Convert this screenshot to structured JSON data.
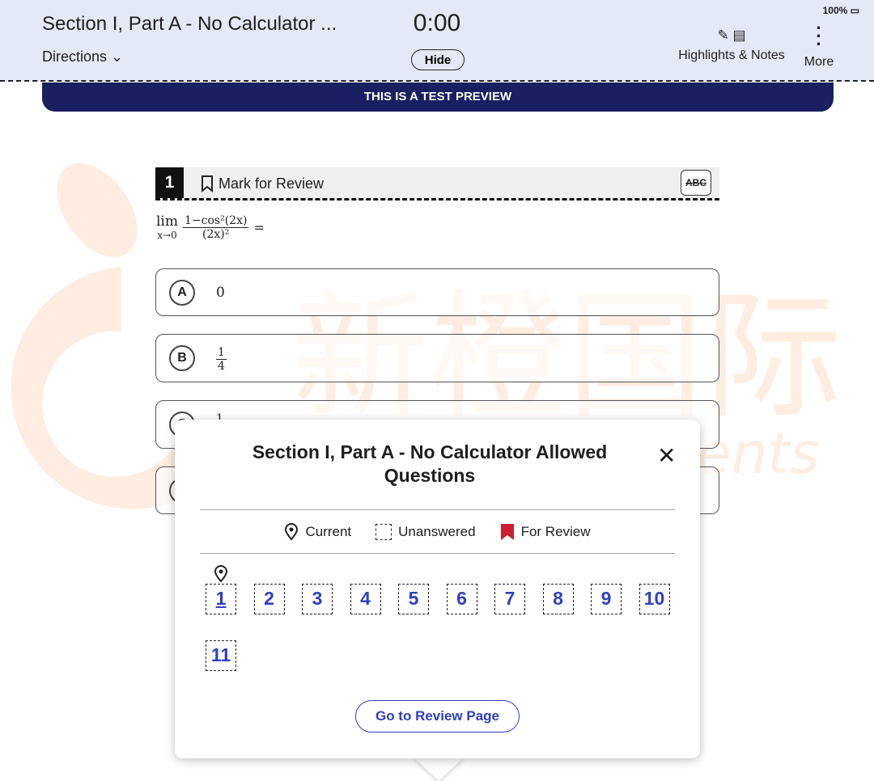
{
  "header": {
    "title": "Section I, Part A - No Calculator ...",
    "directions": "Directions",
    "timer": "0:00",
    "hide": "Hide",
    "highlights": "Highlights & Notes",
    "more": "More",
    "battery": "100%"
  },
  "banner": "THIS IS A TEST PREVIEW",
  "watermark": {
    "cn": "新橙国际",
    "en": "New Achievements"
  },
  "question": {
    "number": "1",
    "mark": "Mark for Review",
    "abc": "ABC",
    "lim": "lim",
    "lim_sub": "x→0",
    "num": "1−cos²(2x)",
    "den": "(2x)²",
    "eq": "=",
    "choices": [
      {
        "letter": "A",
        "value": "0"
      },
      {
        "letter": "B",
        "num": "1",
        "den": "4"
      },
      {
        "letter": "C",
        "value": "1"
      },
      {
        "letter": "D",
        "value": ""
      }
    ]
  },
  "popup": {
    "title": "Section I, Part A - No Calculator Allowed Questions",
    "legend": {
      "current": "Current",
      "unanswered": "Unanswered",
      "review": "For Review"
    },
    "questions": [
      "1",
      "2",
      "3",
      "4",
      "5",
      "6",
      "7",
      "8",
      "9",
      "10",
      "11"
    ],
    "current": "1",
    "review_button": "Go to Review Page"
  },
  "colors": {
    "header_bg": "#e3eaf6",
    "banner": "#1a1f61",
    "link": "#3040c0",
    "review_flag": "#c8202f",
    "watermark": "#f7a36a"
  }
}
